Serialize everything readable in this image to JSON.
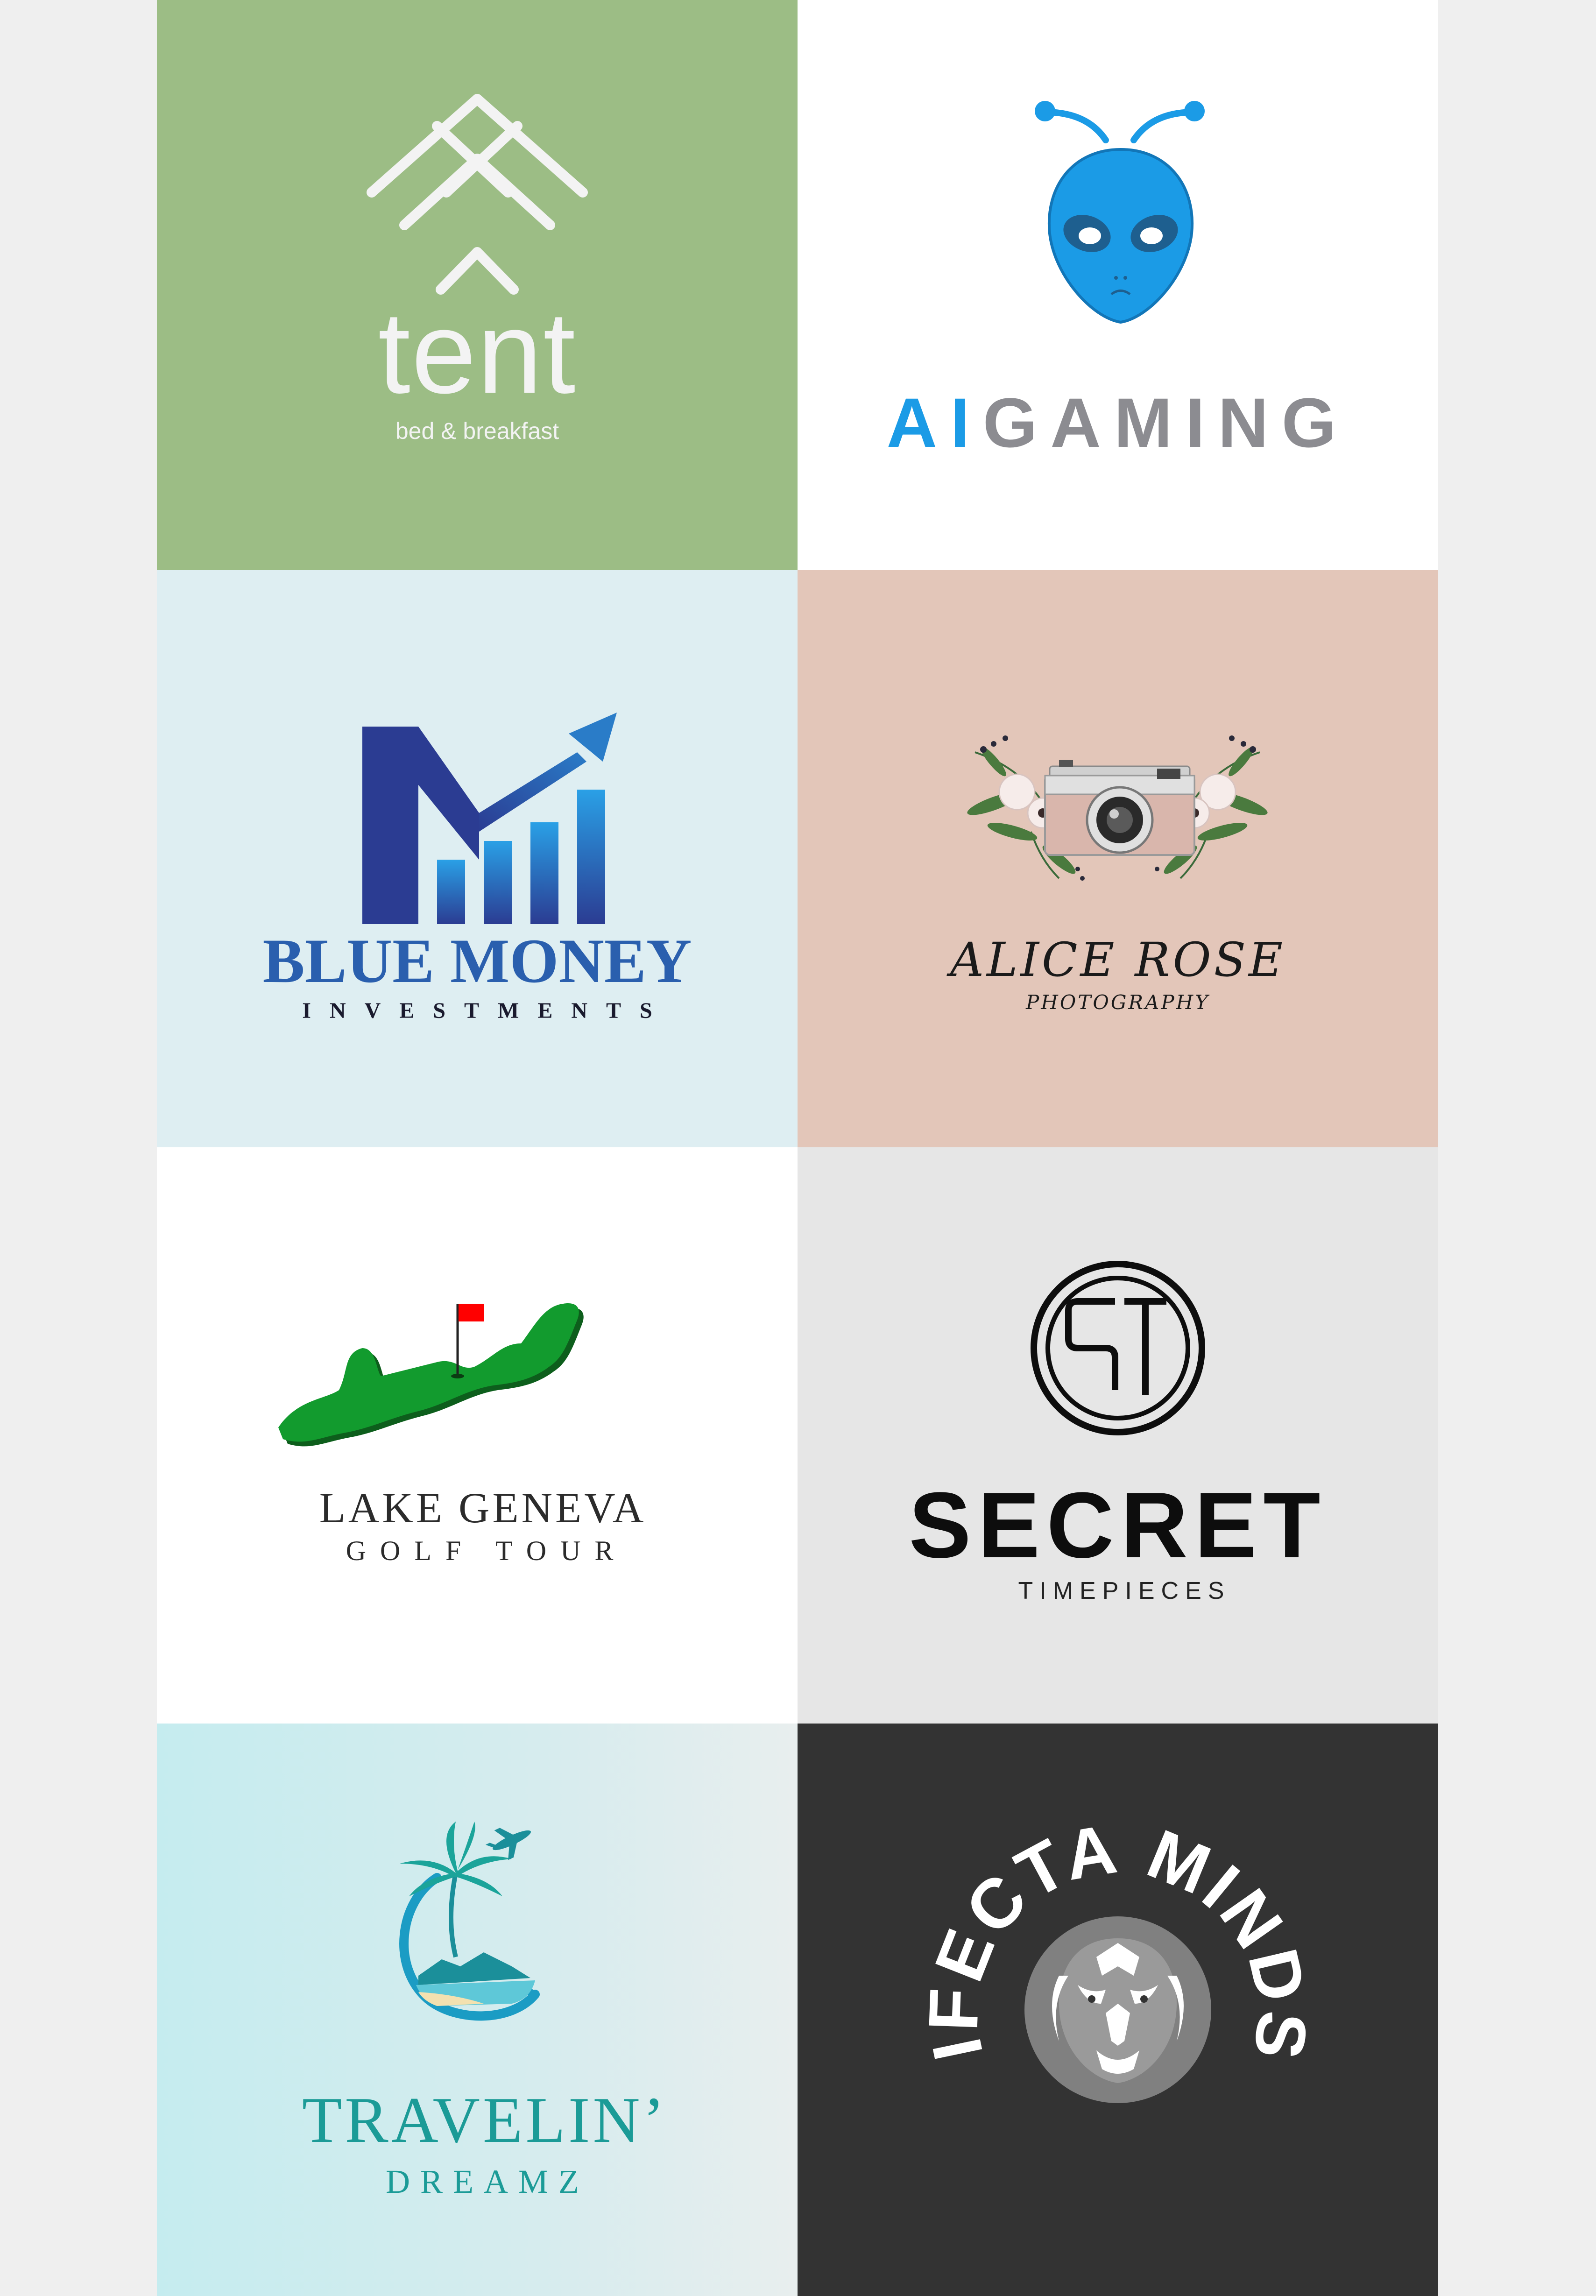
{
  "logos": [
    {
      "brand": "tent",
      "tagline": "bed & breakfast",
      "colors": {
        "background": "#9cbd85",
        "mark": "#f3f3f3"
      }
    },
    {
      "brand_part1": "AI",
      "brand_part2": "GAMING",
      "icon": "alien-head-icon",
      "colors": {
        "background": "#ffffff",
        "accent": "#1b9be6",
        "secondary": "#8c8c91"
      }
    },
    {
      "brand": "BLUE MONEY",
      "tagline": "INVESTMENTS",
      "icon": "growth-arrow-m-icon",
      "colors": {
        "background": "#deeef2",
        "primary": "#2a5fae",
        "dark": "#2b3c92"
      }
    },
    {
      "brand": "ALICE ROSE",
      "tagline": "PHOTOGRAPHY",
      "icon": "camera-with-flowers-icon",
      "colors": {
        "background": "#e3c6b9"
      }
    },
    {
      "brand": "LAKE GENEVA",
      "tagline": "GOLF TOUR",
      "icon": "golf-island-flag-icon",
      "colors": {
        "background": "#ffffff",
        "green": "#129b2e",
        "flag": "#ff0000"
      }
    },
    {
      "brand": "SECRET",
      "tagline": "TIMEPIECES",
      "icon": "st-monogram-circle-icon",
      "colors": {
        "background": "#e6e6e6",
        "text": "#0d0d0d"
      }
    },
    {
      "brand": "TRAVELIN’",
      "tagline": "DREAMZ",
      "icon": "palm-beach-plane-icon",
      "colors": {
        "background": "#c5ecef",
        "teal": "#1b9b97"
      }
    },
    {
      "brand": "TRIFECTA MINDSET",
      "icon": "lion-head-icon",
      "colors": {
        "background": "#333333",
        "text": "#ffffff"
      }
    }
  ]
}
